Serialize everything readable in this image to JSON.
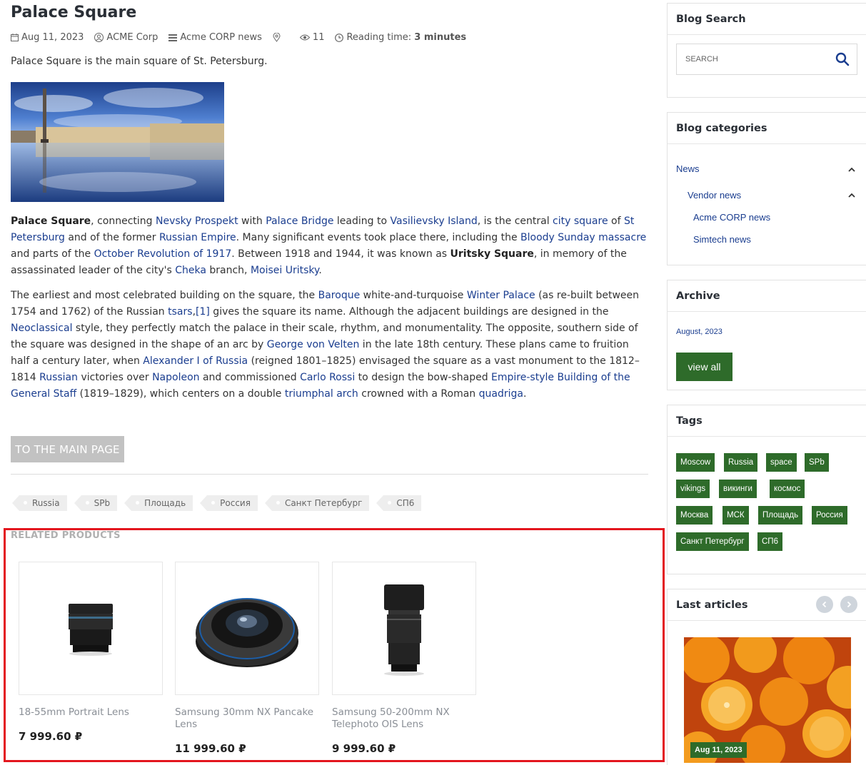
{
  "article": {
    "title": "Palace Square",
    "meta": {
      "date": "Aug 11, 2023",
      "author": "ACME Corp",
      "category": "Acme CORP news",
      "views": "11",
      "reading_label": "Reading time:",
      "reading_value": "3 minutes"
    },
    "intro": "Palace Square is the main square of St. Petersburg.",
    "p1": [
      {
        "t": "b",
        "v": "Palace Square"
      },
      {
        "t": "s",
        "v": ", connecting "
      },
      {
        "t": "a",
        "v": "Nevsky Prospekt"
      },
      {
        "t": "s",
        "v": " with "
      },
      {
        "t": "a",
        "v": "Palace Bridge"
      },
      {
        "t": "s",
        "v": " leading to "
      },
      {
        "t": "a",
        "v": "Vasilievsky Island"
      },
      {
        "t": "s",
        "v": ", is the central "
      },
      {
        "t": "a",
        "v": "city square"
      },
      {
        "t": "s",
        "v": " of "
      },
      {
        "t": "a",
        "v": "St Petersburg"
      },
      {
        "t": "s",
        "v": " and of the former "
      },
      {
        "t": "a",
        "v": "Russian Empire"
      },
      {
        "t": "s",
        "v": ". Many significant events took place there, including the "
      },
      {
        "t": "a",
        "v": "Bloody Sunday massacre"
      },
      {
        "t": "s",
        "v": " and parts of the "
      },
      {
        "t": "a",
        "v": "October Revolution of 1917"
      },
      {
        "t": "s",
        "v": ". Between 1918 and 1944, it was known as "
      },
      {
        "t": "b",
        "v": "Uritsky Square"
      },
      {
        "t": "s",
        "v": ", in memory of the assassinated leader of the city's "
      },
      {
        "t": "a",
        "v": "Cheka"
      },
      {
        "t": "s",
        "v": " branch, "
      },
      {
        "t": "a",
        "v": "Moisei Uritsky"
      },
      {
        "t": "s",
        "v": "."
      }
    ],
    "p2": [
      {
        "t": "s",
        "v": "The earliest and most celebrated building on the square, the "
      },
      {
        "t": "a",
        "v": "Baroque"
      },
      {
        "t": "s",
        "v": " white-and-turquoise "
      },
      {
        "t": "a",
        "v": "Winter Palace"
      },
      {
        "t": "s",
        "v": " (as re-built between 1754 and 1762) of the Russian "
      },
      {
        "t": "a",
        "v": "tsars"
      },
      {
        "t": "s",
        "v": ","
      },
      {
        "t": "a",
        "v": "[1]"
      },
      {
        "t": "s",
        "v": " gives the square its name. Although the adjacent buildings are designed in the "
      },
      {
        "t": "a",
        "v": "Neoclassical"
      },
      {
        "t": "s",
        "v": " style, they perfectly match the palace in their scale, rhythm, and monumentality. The opposite, southern side of the square was designed in the shape of an arc by "
      },
      {
        "t": "a",
        "v": "George von Velten"
      },
      {
        "t": "s",
        "v": " in the late 18th century. These plans came to fruition half a century later, when "
      },
      {
        "t": "a",
        "v": "Alexander I of Russia"
      },
      {
        "t": "s",
        "v": " (reigned 1801–1825) envisaged the square as a vast monument to the 1812–1814 "
      },
      {
        "t": "a",
        "v": "Russian"
      },
      {
        "t": "s",
        "v": " victories over "
      },
      {
        "t": "a",
        "v": "Napoleon"
      },
      {
        "t": "s",
        "v": " and commissioned "
      },
      {
        "t": "a",
        "v": "Carlo Rossi"
      },
      {
        "t": "s",
        "v": " to design the bow-shaped "
      },
      {
        "t": "a",
        "v": "Empire-style"
      },
      {
        "t": "s",
        "v": " "
      },
      {
        "t": "a",
        "v": "Building of the General Staff"
      },
      {
        "t": "s",
        "v": " (1819–1829), which centers on a double "
      },
      {
        "t": "a",
        "v": "triumphal arch"
      },
      {
        "t": "s",
        "v": " crowned with a Roman "
      },
      {
        "t": "a",
        "v": "quadriga"
      },
      {
        "t": "s",
        "v": "."
      }
    ],
    "main_page_button": "TO THE MAIN PAGE",
    "tags": [
      "Russia",
      "SPb",
      "Площадь",
      "Россия",
      "Санкт Петербург",
      "СП6"
    ]
  },
  "related": {
    "title": "RELATED PRODUCTS",
    "products": [
      {
        "name": "18-55mm Portrait Lens",
        "price": "7 999.60 ₽"
      },
      {
        "name": "Samsung 30mm NX Pancake Lens",
        "price": "11 999.60 ₽"
      },
      {
        "name": "Samsung 50-200mm NX Telephoto OIS Lens",
        "price": "9 999.60 ₽"
      }
    ]
  },
  "sidebar": {
    "search": {
      "title": "Blog Search",
      "placeholder": "SEARCH"
    },
    "categories": {
      "title": "Blog categories",
      "items": [
        "News",
        "Vendor news",
        "Acme CORP news",
        "Simtech news"
      ]
    },
    "archive": {
      "title": "Archive",
      "link": "August, 2023",
      "view_all": "view all"
    },
    "tags": {
      "title": "Tags",
      "items": [
        "Moscow",
        "Russia",
        "space",
        "SPb",
        "vikings",
        "викинги",
        "космос",
        "Москва",
        "МСК",
        "Площадь",
        "Россия",
        "Санкт Петербург",
        "СП6"
      ]
    },
    "last_articles": {
      "title": "Last articles",
      "date": "Aug 11, 2023"
    }
  },
  "colors": {
    "link": "#1a3d8f",
    "accent_green": "#2e6b2a",
    "highlight_red": "#e3161e"
  }
}
